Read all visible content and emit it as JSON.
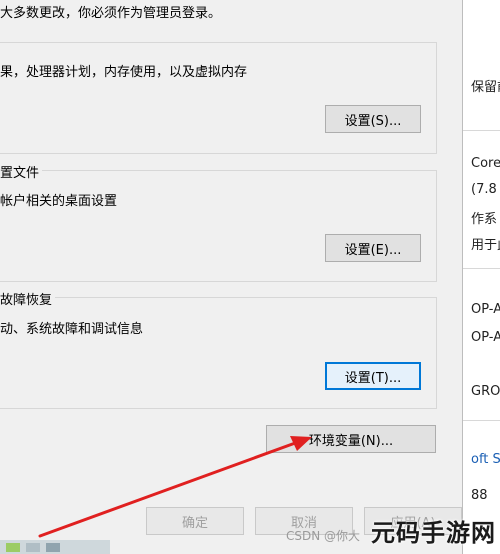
{
  "dialog": {
    "intro_text": "大多数更改，你必须作为管理员登录。",
    "performance": {
      "desc": "果，处理器计划，内存使用，以及虚拟内存",
      "button": "设置(S)..."
    },
    "user_profiles": {
      "title": "置文件",
      "desc": "帐户相关的桌面设置",
      "button": "设置(E)..."
    },
    "startup_recovery": {
      "title": "故障恢复",
      "desc": "动、系统故障和调试信息",
      "button": "设置(T)..."
    },
    "env_button": "环境变量(N)...",
    "ok_button": "确定",
    "cancel_button": "取消",
    "apply_button": "应用(A)"
  },
  "right_window": {
    "lines": [
      "保留前",
      "Core",
      "(7.8",
      "作系",
      "用于此",
      "OP-A",
      "OP-A",
      "GROU",
      "oft S",
      "88"
    ]
  },
  "watermarks": {
    "csdn": "CSDN @你大",
    "site": "元码手游网"
  },
  "colors": {
    "accent": "#0078d7",
    "arrow": "#e02020"
  }
}
